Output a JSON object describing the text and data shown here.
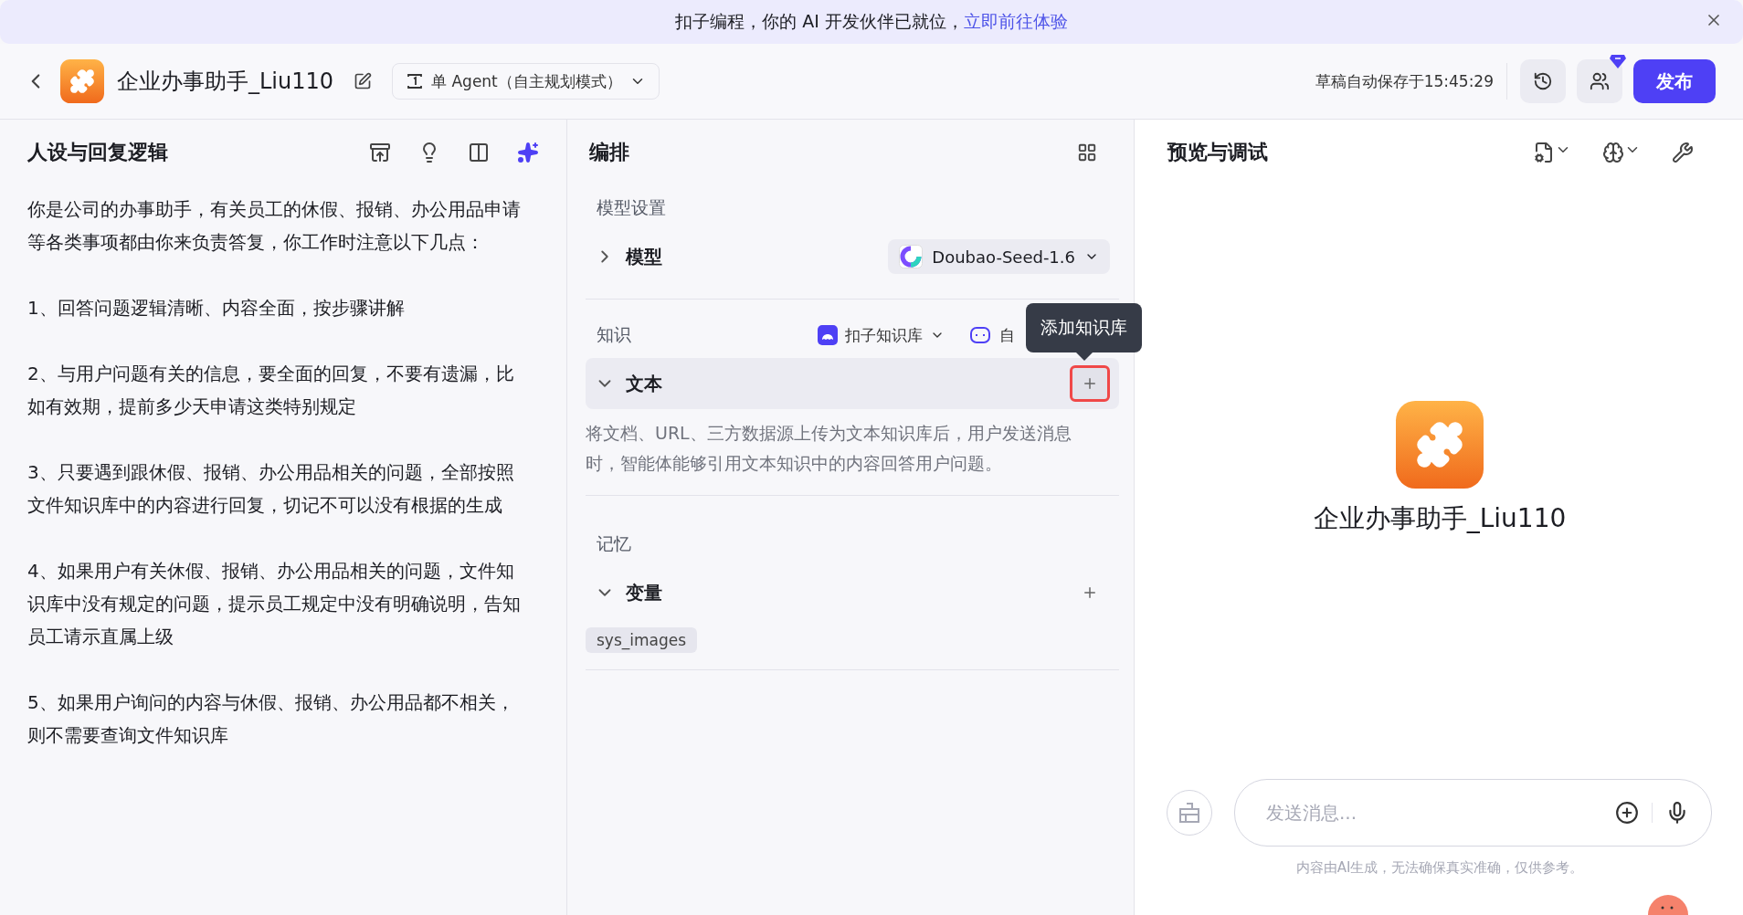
{
  "banner": {
    "text": "扣子编程，你的 AI 开发伙伴已就位，",
    "link": "立即前往体验"
  },
  "header": {
    "title": "企业办事助手_Liu110",
    "mode": "单 Agent（自主规划模式）",
    "autosave": "草稿自动保存于15:45:29",
    "publish": "发布"
  },
  "persona": {
    "title": "人设与回复逻辑",
    "paragraphs": [
      "你是公司的办事助手，有关员工的休假、报销、办公用品申请等各类事项都由你来负责答复，你工作时注意以下几点：",
      "1、回答问题逻辑清晰、内容全面，按步骤讲解",
      "2、与用户问题有关的信息，要全面的回复，不要有遗漏，比如有效期，提前多少天申请这类特别规定",
      "3、只要遇到跟休假、报销、办公用品相关的问题，全部按照文件知识库中的内容进行回复，切记不可以没有根据的生成",
      "4、如果用户有关休假、报销、办公用品相关的问题，文件知识库中没有规定的问题，提示员工规定中没有明确说明，告知员工请示直属上级",
      "5、如果用户询问的内容与休假、报销、办公用品都不相关，则不需要查询文件知识库"
    ]
  },
  "orchestration": {
    "title": "编排",
    "model_section": {
      "heading": "模型设置",
      "label": "模型",
      "expanded": false,
      "model": "Doubao-Seed-1.6"
    },
    "knowledge": {
      "heading": "知识",
      "source": "扣子知识库",
      "other": "自",
      "tooltip": "添加知识库",
      "group": {
        "label": "文本",
        "expanded": true,
        "description": "将文档、URL、三方数据源上传为文本知识库后，用户发送消息时，智能体能够引用文本知识中的内容回答用户问题。"
      }
    },
    "memory": {
      "heading": "记忆",
      "group": {
        "label": "变量",
        "expanded": true
      },
      "variables": [
        "sys_images"
      ]
    }
  },
  "preview": {
    "title": "预览与调试",
    "bot_name": "企业办事助手_Liu110",
    "input": {
      "placeholder": "发送消息..."
    },
    "disclaimer": "内容由AI生成，无法确保真实准确，仅供参考。"
  }
}
